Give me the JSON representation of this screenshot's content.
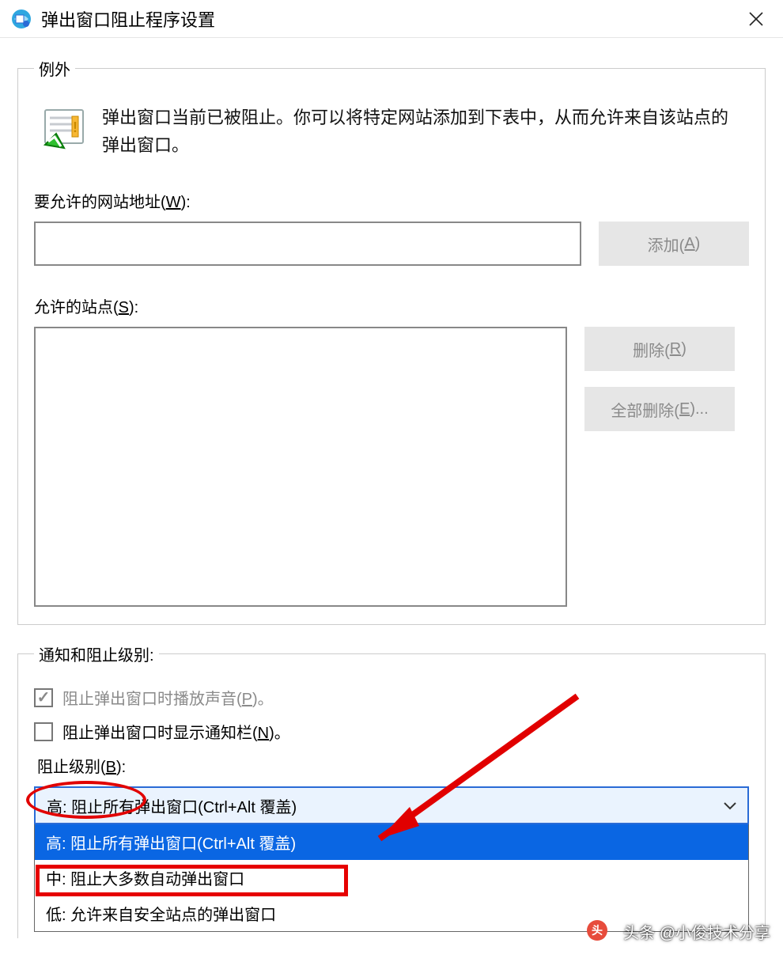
{
  "window": {
    "title": "弹出窗口阻止程序设置"
  },
  "exceptions": {
    "legend": "例外",
    "info_text": "弹出窗口当前已被阻止。你可以将特定网站添加到下表中，从而允许来自该站点的弹出窗口。",
    "address_label_pre": "要允许的网站地址(",
    "address_label_u": "W",
    "address_label_post": "):",
    "address_value": "",
    "add_button_pre": "添加(",
    "add_button_u": "A",
    "add_button_post": ")",
    "allowed_label_pre": "允许的站点(",
    "allowed_label_u": "S",
    "allowed_label_post": "):",
    "remove_button_pre": "删除(",
    "remove_button_u": "R",
    "remove_button_post": ")",
    "remove_all_button_pre": "全部删除(",
    "remove_all_button_u": "E",
    "remove_all_button_post": ")..."
  },
  "notify": {
    "legend": "通知和阻止级别:",
    "sound_pre": "阻止弹出窗口时播放声音(",
    "sound_u": "P",
    "sound_post": ")。",
    "bar_pre": "阻止弹出窗口时显示通知栏(",
    "bar_u": "N",
    "bar_post": ")。",
    "level_label_pre": "阻止级别(",
    "level_label_u": "B",
    "level_label_post": "):",
    "dropdown_value": "高: 阻止所有弹出窗口(Ctrl+Alt 覆盖)",
    "options": [
      "高: 阻止所有弹出窗口(Ctrl+Alt 覆盖)",
      "中: 阻止大多数自动弹出窗口",
      "低: 允许来自安全站点的弹出窗口"
    ]
  },
  "watermark": {
    "logo_char": "头",
    "text": "头条 @小俊技术分享"
  }
}
